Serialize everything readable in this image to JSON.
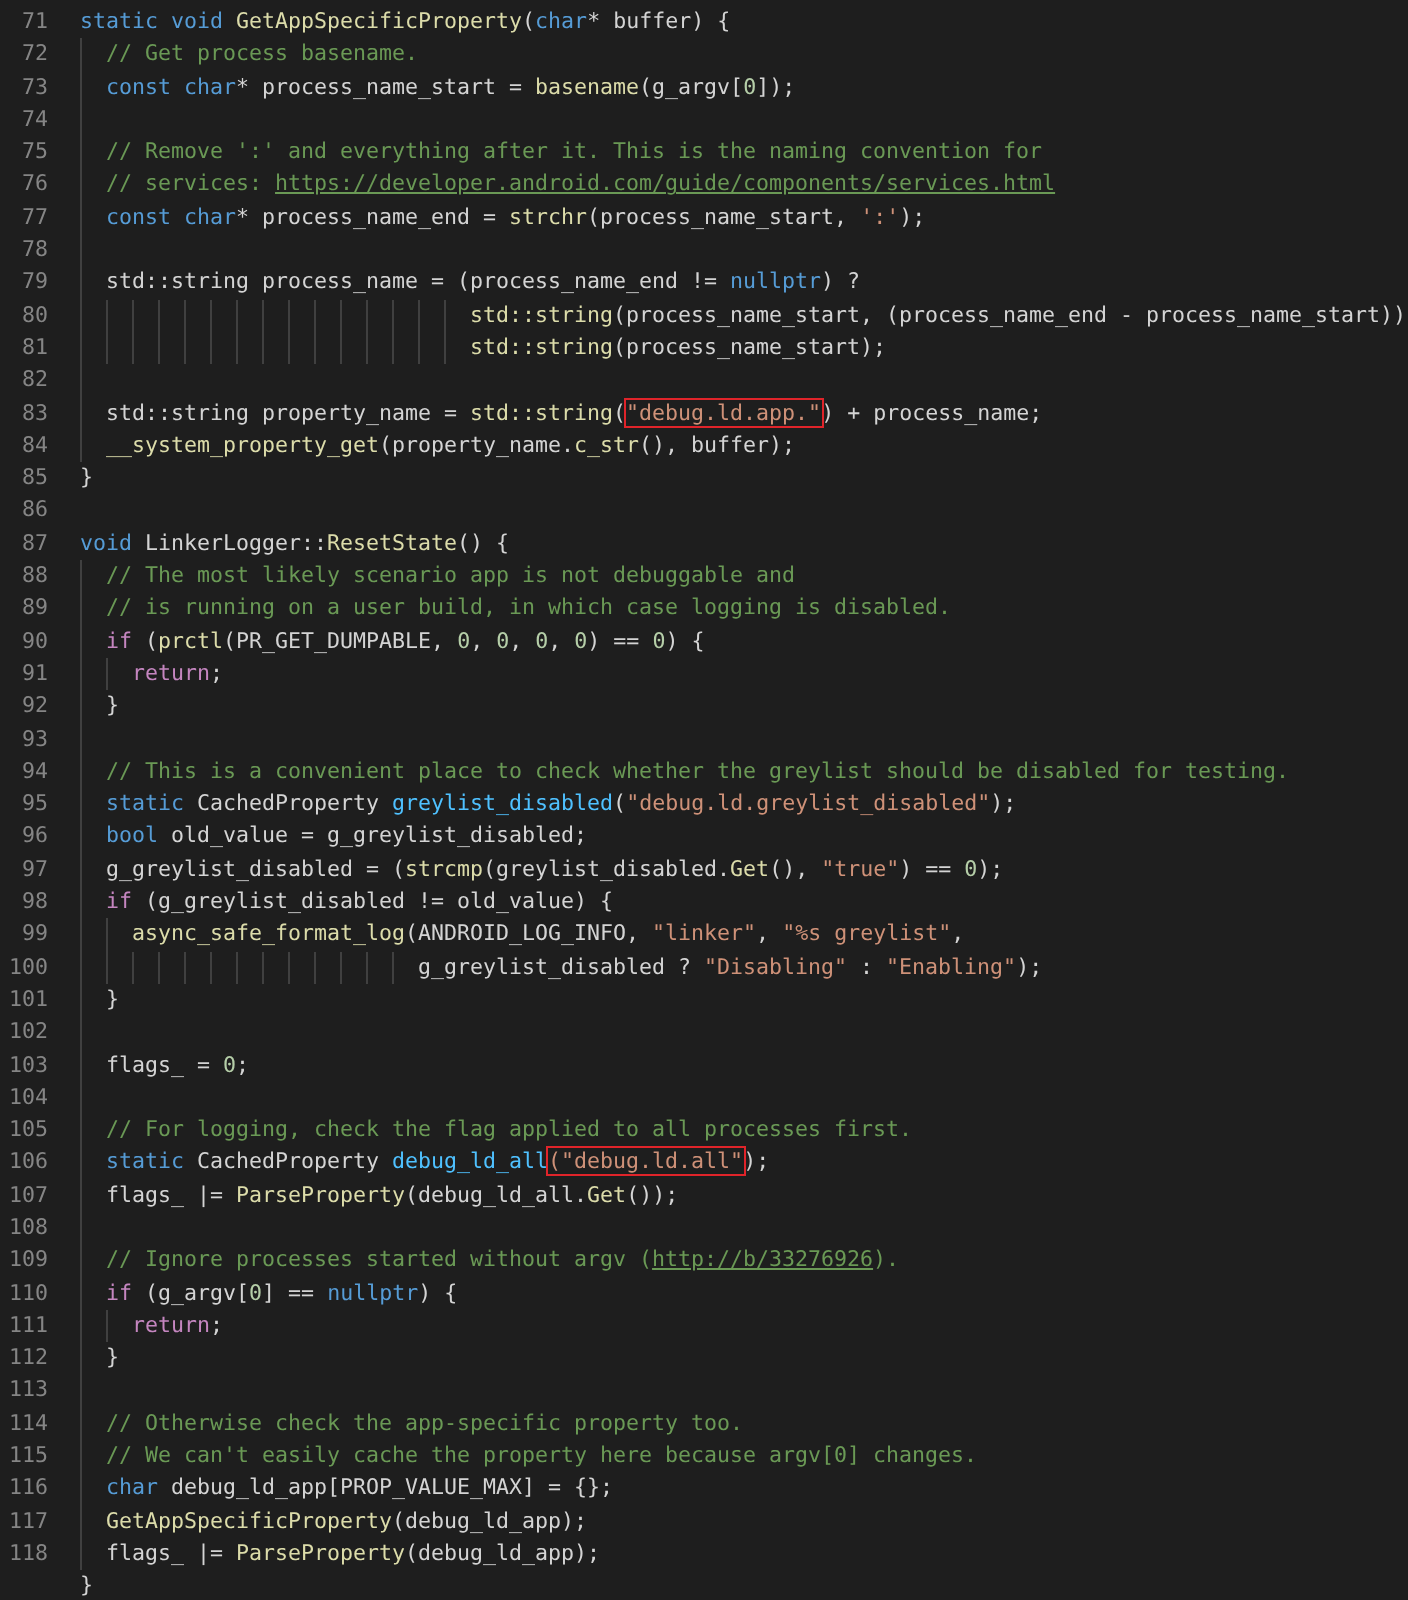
{
  "lines": [
    {
      "number": "71",
      "tokens": [
        {
          "kind": "keyword",
          "text": "static void "
        },
        {
          "kind": "function",
          "text": "GetAppSpecificProperty"
        },
        {
          "kind": "plain",
          "text": "("
        },
        {
          "kind": "keyword",
          "text": "char"
        },
        {
          "kind": "plain",
          "text": "* buffer) {"
        }
      ]
    },
    {
      "number": "72",
      "tokens": [
        {
          "kind": "comment",
          "text": "  // Get process basename."
        }
      ]
    },
    {
      "number": "73",
      "tokens": [
        {
          "kind": "keyword",
          "text": "  const char"
        },
        {
          "kind": "plain",
          "text": "* process_name_start = "
        },
        {
          "kind": "function",
          "text": "basename"
        },
        {
          "kind": "plain",
          "text": "(g_argv["
        },
        {
          "kind": "number",
          "text": "0"
        },
        {
          "kind": "plain",
          "text": "]);"
        }
      ]
    },
    {
      "number": "74",
      "guide": true
    },
    {
      "number": "75",
      "tokens": [
        {
          "kind": "comment",
          "text": "  // Remove ':' and everything after it. This is the naming convention for"
        }
      ]
    },
    {
      "number": "76",
      "tokens": [
        {
          "kind": "comment",
          "text": "  // services: "
        },
        {
          "kind": "link",
          "text": "https://developer.android.com/guide/components/services.html"
        }
      ]
    },
    {
      "number": "77",
      "tokens": [
        {
          "kind": "keyword",
          "text": "  const char"
        },
        {
          "kind": "plain",
          "text": "* process_name_end = "
        },
        {
          "kind": "function",
          "text": "strchr"
        },
        {
          "kind": "plain",
          "text": "(process_name_start, "
        },
        {
          "kind": "string",
          "text": "':'"
        },
        {
          "kind": "plain",
          "text": ");"
        }
      ]
    },
    {
      "number": "78",
      "guide": true
    },
    {
      "number": "79",
      "tokens": [
        {
          "kind": "plain",
          "text": "  std::string process_name = (process_name_end != "
        },
        {
          "kind": "keyword",
          "text": "nullptr"
        },
        {
          "kind": "plain",
          "text": ") ?"
        }
      ]
    },
    {
      "number": "80",
      "tokens": [
        {
          "kind": "function",
          "text": "                              std::string"
        },
        {
          "kind": "plain",
          "text": "(process_name_start, (process_name_end - process_name_start))"
        }
      ]
    },
    {
      "number": "81",
      "tokens": [
        {
          "kind": "function",
          "text": "                              std::string"
        },
        {
          "kind": "plain",
          "text": "(process_name_start);"
        }
      ]
    },
    {
      "number": "82",
      "guide": true
    },
    {
      "number": "83",
      "tokens": [
        {
          "kind": "plain",
          "text": "  std::string property_name = "
        },
        {
          "kind": "function",
          "text": "std::string"
        },
        {
          "kind": "plain",
          "text": "("
        },
        {
          "kind": "string",
          "text": "\"debug.ld.app.\"",
          "boxed": true
        },
        {
          "kind": "plain",
          "text": ") + process_name;"
        }
      ]
    },
    {
      "number": "84",
      "tokens": [
        {
          "kind": "function",
          "text": "  __system_property_get"
        },
        {
          "kind": "plain",
          "text": "(property_name."
        },
        {
          "kind": "function",
          "text": "c_str"
        },
        {
          "kind": "plain",
          "text": "(), buffer);"
        }
      ]
    },
    {
      "number": "85",
      "tokens": [
        {
          "kind": "plain",
          "text": "}"
        }
      ]
    },
    {
      "number": "86"
    },
    {
      "number": "87",
      "tokens": [
        {
          "kind": "keyword",
          "text": "void"
        },
        {
          "kind": "plain",
          "text": " LinkerLogger::"
        },
        {
          "kind": "function",
          "text": "ResetState"
        },
        {
          "kind": "plain",
          "text": "() {"
        }
      ]
    },
    {
      "number": "88",
      "tokens": [
        {
          "kind": "comment",
          "text": "  // The most likely scenario app is not debuggable and"
        }
      ]
    },
    {
      "number": "89",
      "tokens": [
        {
          "kind": "comment",
          "text": "  // is running on a user build, in which case logging is disabled."
        }
      ]
    },
    {
      "number": "90",
      "tokens": [
        {
          "kind": "control",
          "text": "  if"
        },
        {
          "kind": "plain",
          "text": " ("
        },
        {
          "kind": "function",
          "text": "prctl"
        },
        {
          "kind": "plain",
          "text": "(PR_GET_DUMPABLE, "
        },
        {
          "kind": "number",
          "text": "0"
        },
        {
          "kind": "plain",
          "text": ", "
        },
        {
          "kind": "number",
          "text": "0"
        },
        {
          "kind": "plain",
          "text": ", "
        },
        {
          "kind": "number",
          "text": "0"
        },
        {
          "kind": "plain",
          "text": ", "
        },
        {
          "kind": "number",
          "text": "0"
        },
        {
          "kind": "plain",
          "text": ") == "
        },
        {
          "kind": "number",
          "text": "0"
        },
        {
          "kind": "plain",
          "text": ") {"
        }
      ]
    },
    {
      "number": "91",
      "tokens": [
        {
          "kind": "control",
          "text": "    return"
        },
        {
          "kind": "plain",
          "text": ";"
        }
      ]
    },
    {
      "number": "92",
      "tokens": [
        {
          "kind": "plain",
          "text": "  }"
        }
      ]
    },
    {
      "number": "93",
      "guide": true
    },
    {
      "number": "94",
      "tokens": [
        {
          "kind": "comment",
          "text": "  // This is a convenient place to check whether the greylist should be disabled for testing."
        }
      ]
    },
    {
      "number": "95",
      "tokens": [
        {
          "kind": "keyword",
          "text": "  static"
        },
        {
          "kind": "plain",
          "text": " CachedProperty "
        },
        {
          "kind": "variable",
          "text": "greylist_disabled"
        },
        {
          "kind": "plain",
          "text": "("
        },
        {
          "kind": "string",
          "text": "\"debug.ld.greylist_disabled\""
        },
        {
          "kind": "plain",
          "text": ");"
        }
      ]
    },
    {
      "number": "96",
      "tokens": [
        {
          "kind": "keyword",
          "text": "  bool"
        },
        {
          "kind": "plain",
          "text": " old_value = g_greylist_disabled;"
        }
      ]
    },
    {
      "number": "97",
      "tokens": [
        {
          "kind": "plain",
          "text": "  g_greylist_disabled = ("
        },
        {
          "kind": "function",
          "text": "strcmp"
        },
        {
          "kind": "plain",
          "text": "(greylist_disabled."
        },
        {
          "kind": "function",
          "text": "Get"
        },
        {
          "kind": "plain",
          "text": "(), "
        },
        {
          "kind": "string",
          "text": "\"true\""
        },
        {
          "kind": "plain",
          "text": ") == "
        },
        {
          "kind": "number",
          "text": "0"
        },
        {
          "kind": "plain",
          "text": ");"
        }
      ]
    },
    {
      "number": "98",
      "tokens": [
        {
          "kind": "control",
          "text": "  if"
        },
        {
          "kind": "plain",
          "text": " (g_greylist_disabled != old_value) {"
        }
      ]
    },
    {
      "number": "99",
      "tokens": [
        {
          "kind": "function",
          "text": "    async_safe_format_log"
        },
        {
          "kind": "plain",
          "text": "(ANDROID_LOG_INFO, "
        },
        {
          "kind": "string",
          "text": "\"linker\""
        },
        {
          "kind": "plain",
          "text": ", "
        },
        {
          "kind": "string",
          "text": "\"%s greylist\""
        },
        {
          "kind": "plain",
          "text": ","
        }
      ]
    },
    {
      "number": "100",
      "tokens": [
        {
          "kind": "plain",
          "text": "                          g_greylist_disabled ? "
        },
        {
          "kind": "string",
          "text": "\"Disabling\""
        },
        {
          "kind": "plain",
          "text": " : "
        },
        {
          "kind": "string",
          "text": "\"Enabling\""
        },
        {
          "kind": "plain",
          "text": ");"
        }
      ]
    },
    {
      "number": "101",
      "tokens": [
        {
          "kind": "plain",
          "text": "  }"
        }
      ]
    },
    {
      "number": "102",
      "guide": true
    },
    {
      "number": "103",
      "tokens": [
        {
          "kind": "plain",
          "text": "  flags_ = "
        },
        {
          "kind": "number",
          "text": "0"
        },
        {
          "kind": "plain",
          "text": ";"
        }
      ]
    },
    {
      "number": "104",
      "guide": true
    },
    {
      "number": "105",
      "tokens": [
        {
          "kind": "comment",
          "text": "  // For logging, check the flag applied to all processes first."
        }
      ]
    },
    {
      "number": "106",
      "tokens": [
        {
          "kind": "keyword",
          "text": "  static"
        },
        {
          "kind": "plain",
          "text": " CachedProperty "
        },
        {
          "kind": "variable",
          "text": "debug_ld_all"
        },
        {
          "kind": "string",
          "text": "(\"debug.ld.all\"",
          "boxed": true
        },
        {
          "kind": "plain",
          "text": ");"
        }
      ]
    },
    {
      "number": "107",
      "tokens": [
        {
          "kind": "plain",
          "text": "  flags_ |= "
        },
        {
          "kind": "function",
          "text": "ParseProperty"
        },
        {
          "kind": "plain",
          "text": "(debug_ld_all."
        },
        {
          "kind": "function",
          "text": "Get"
        },
        {
          "kind": "plain",
          "text": "());"
        }
      ]
    },
    {
      "number": "108",
      "guide": true
    },
    {
      "number": "109",
      "tokens": [
        {
          "kind": "comment",
          "text": "  // Ignore processes started without argv ("
        },
        {
          "kind": "link",
          "text": "http://b/33276926"
        },
        {
          "kind": "comment",
          "text": ")."
        }
      ]
    },
    {
      "number": "110",
      "tokens": [
        {
          "kind": "control",
          "text": "  if"
        },
        {
          "kind": "plain",
          "text": " (g_argv["
        },
        {
          "kind": "number",
          "text": "0"
        },
        {
          "kind": "plain",
          "text": "] == "
        },
        {
          "kind": "keyword",
          "text": "nullptr"
        },
        {
          "kind": "plain",
          "text": ") {"
        }
      ]
    },
    {
      "number": "111",
      "tokens": [
        {
          "kind": "control",
          "text": "    return"
        },
        {
          "kind": "plain",
          "text": ";"
        }
      ]
    },
    {
      "number": "112",
      "tokens": [
        {
          "kind": "plain",
          "text": "  }"
        }
      ]
    },
    {
      "number": "113",
      "guide": true
    },
    {
      "number": "114",
      "tokens": [
        {
          "kind": "comment",
          "text": "  // Otherwise check the app-specific property too."
        }
      ]
    },
    {
      "number": "115",
      "tokens": [
        {
          "kind": "comment",
          "text": "  // We can't easily cache the property here because argv[0] changes."
        }
      ]
    },
    {
      "number": "116",
      "tokens": [
        {
          "kind": "keyword",
          "text": "  char"
        },
        {
          "kind": "plain",
          "text": " debug_ld_app[PROP_VALUE_MAX] = {};"
        }
      ]
    },
    {
      "number": "117",
      "tokens": [
        {
          "kind": "function",
          "text": "  GetAppSpecificProperty"
        },
        {
          "kind": "plain",
          "text": "(debug_ld_app);"
        }
      ]
    },
    {
      "number": "118",
      "tokens": [
        {
          "kind": "plain",
          "text": "  flags_ |= "
        },
        {
          "kind": "function",
          "text": "ParseProperty"
        },
        {
          "kind": "plain",
          "text": "(debug_ld_app);"
        }
      ]
    },
    {
      "tokens": [
        {
          "kind": "plain",
          "text": "}"
        }
      ]
    }
  ]
}
